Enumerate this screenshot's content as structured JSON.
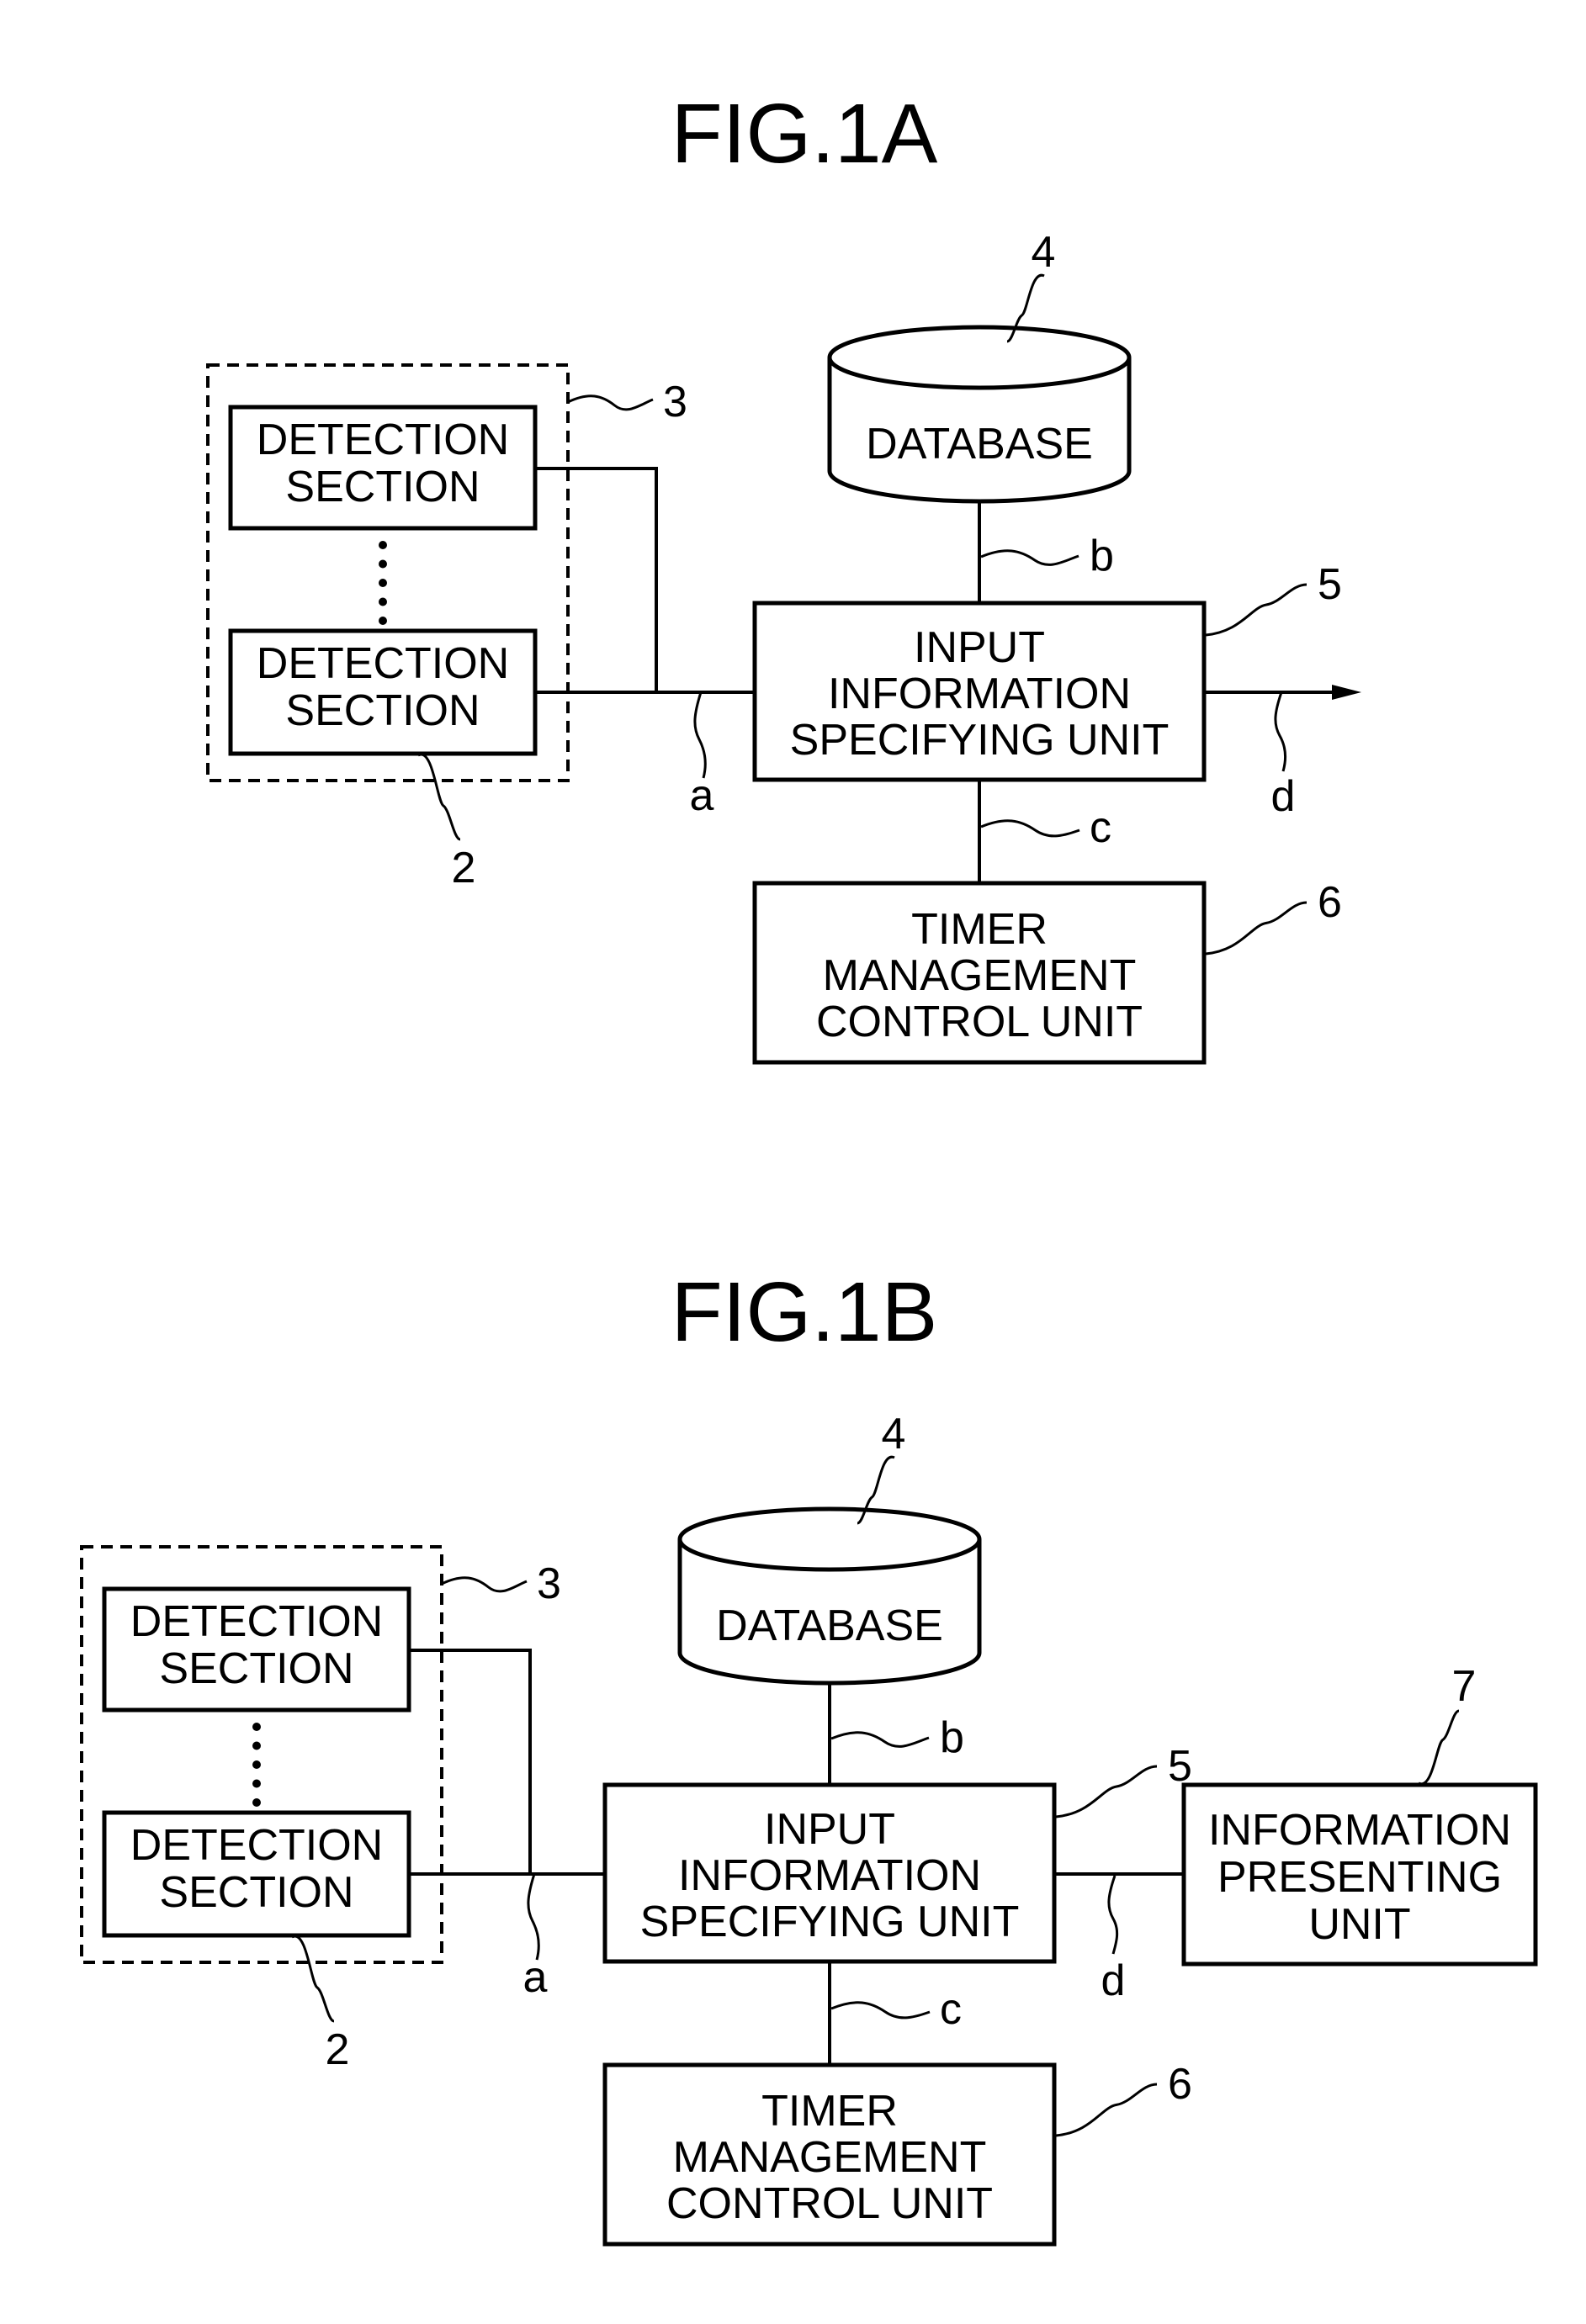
{
  "figures": [
    {
      "id": "fig1a",
      "title": "FIG.1A",
      "detection_group_ref": "3",
      "detection_sections": [
        {
          "lines": [
            "DETECTION",
            "SECTION"
          ]
        },
        {
          "lines": [
            "DETECTION",
            "SECTION"
          ],
          "ref": "2"
        }
      ],
      "database": {
        "label": "DATABASE",
        "ref": "4"
      },
      "input_unit": {
        "lines": [
          "INPUT",
          "INFORMATION",
          "SPECIFYING  UNIT"
        ],
        "ref": "5"
      },
      "timer_unit": {
        "lines": [
          "TIMER",
          "MANAGEMENT",
          "CONTROL  UNIT"
        ],
        "ref": "6"
      },
      "signals": {
        "a": "a",
        "b": "b",
        "c": "c",
        "d": "d"
      },
      "output": "arrow"
    },
    {
      "id": "fig1b",
      "title": "FIG.1B",
      "detection_group_ref": "3",
      "detection_sections": [
        {
          "lines": [
            "DETECTION",
            "SECTION"
          ]
        },
        {
          "lines": [
            "DETECTION",
            "SECTION"
          ],
          "ref": "2"
        }
      ],
      "database": {
        "label": "DATABASE",
        "ref": "4"
      },
      "input_unit": {
        "lines": [
          "INPUT",
          "INFORMATION",
          "SPECIFYING  UNIT"
        ],
        "ref": "5"
      },
      "timer_unit": {
        "lines": [
          "TIMER",
          "MANAGEMENT",
          "CONTROL  UNIT"
        ],
        "ref": "6"
      },
      "presenting_unit": {
        "lines": [
          "INFORMATION",
          "PRESENTING",
          "UNIT"
        ],
        "ref": "7"
      },
      "signals": {
        "a": "a",
        "b": "b",
        "c": "c",
        "d": "d"
      },
      "output": "presenting_unit"
    }
  ]
}
